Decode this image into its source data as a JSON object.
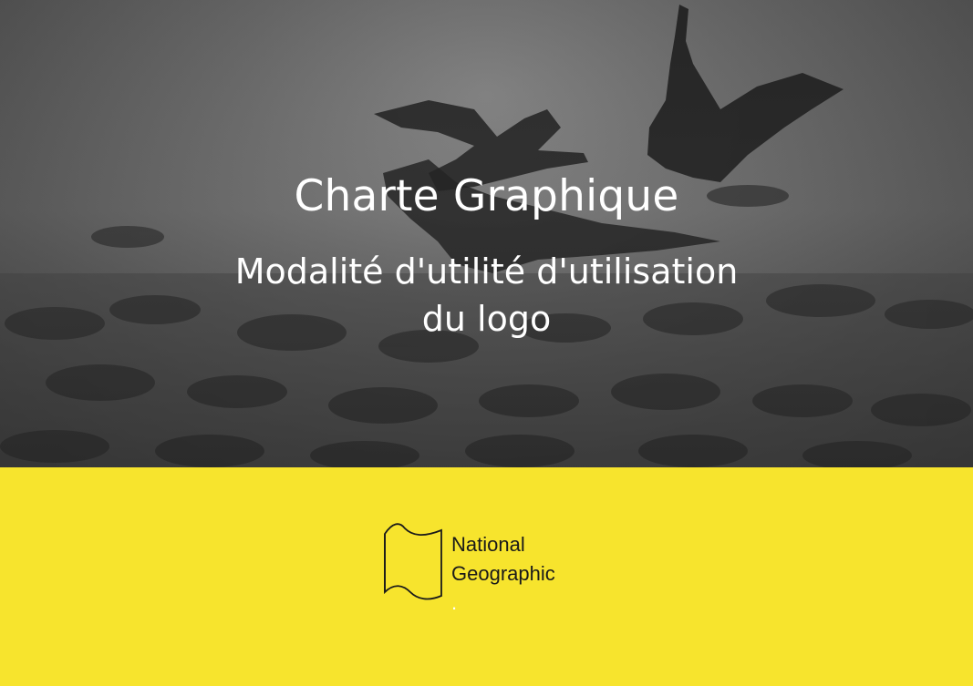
{
  "hero": {
    "title": "Charte Graphique",
    "subtitle_line1": "Modalité d'utilité d'utilisation",
    "subtitle_line2": "du logo"
  },
  "logo": {
    "line1": "National",
    "line2": "Geographic",
    "dot": "."
  },
  "colors": {
    "band": "#f7e42d",
    "text_light": "#ffffff",
    "text_dark": "#1a1a1a"
  },
  "icons": [
    "geese-silhouettes",
    "flag-outline-icon"
  ]
}
